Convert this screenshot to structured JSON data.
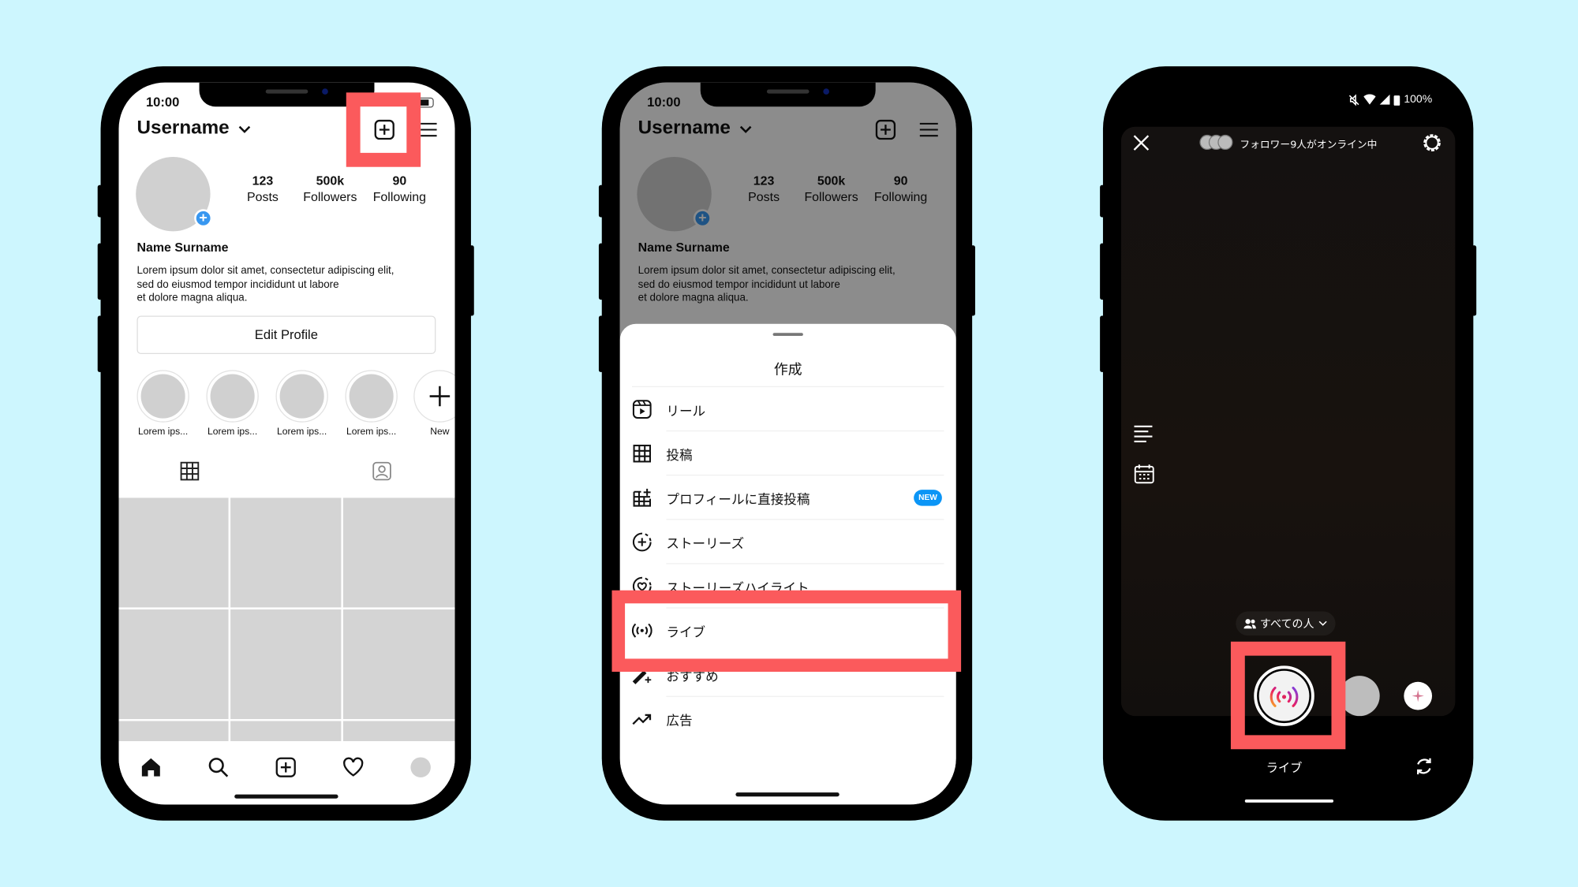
{
  "colors": {
    "background": "#cdf6fe",
    "highlight": "#fb5a5c",
    "accent_blue": "#3897f0"
  },
  "profile": {
    "status_time": "10:00",
    "username": "Username",
    "stats": [
      {
        "value": "123",
        "label": "Posts"
      },
      {
        "value": "500k",
        "label": "Followers"
      },
      {
        "value": "90",
        "label": "Following"
      }
    ],
    "name": "Name Surname",
    "bio": [
      "Lorem ipsum dolor sit amet, consectetur adipiscing elit,",
      "sed do eiusmod tempor incididunt ut labore",
      "et dolore magna aliqua."
    ],
    "edit_profile": "Edit Profile",
    "highlights": [
      "Lorem ips...",
      "Lorem ips...",
      "Lorem ips...",
      "Lorem ips...",
      "New"
    ],
    "icons": {
      "create": "plus-square-icon",
      "menu": "hamburger-icon",
      "grid_tab": "grid-icon",
      "tagged_tab": "person-tag-icon"
    },
    "nav": [
      "home-icon",
      "search-icon",
      "plus-square-icon",
      "heart-icon",
      "avatar"
    ]
  },
  "create_sheet": {
    "title": "作成",
    "items": [
      {
        "label": "リール",
        "icon": "reels-icon"
      },
      {
        "label": "投稿",
        "icon": "grid-icon"
      },
      {
        "label": "プロフィールに直接投稿",
        "icon": "grid-plus-icon",
        "badge": "NEW"
      },
      {
        "label": "ストーリーズ",
        "icon": "story-plus-icon"
      },
      {
        "label": "ストーリーズハイライト",
        "icon": "story-heart-icon"
      },
      {
        "label": "ライブ",
        "icon": "live-icon",
        "highlighted": true
      },
      {
        "label": "おすすめ",
        "icon": "magic-wand-icon"
      },
      {
        "label": "広告",
        "icon": "trend-arrow-icon"
      }
    ]
  },
  "live": {
    "battery": "100%",
    "followers_online": "フォロワー9人がオンライン中",
    "audience": "すべての人",
    "mode_label": "ライブ",
    "icons": {
      "close": "close-icon",
      "settings": "gear-icon",
      "title": "text-lines-icon",
      "schedule": "calendar-icon",
      "flip": "flip-camera-icon"
    }
  }
}
